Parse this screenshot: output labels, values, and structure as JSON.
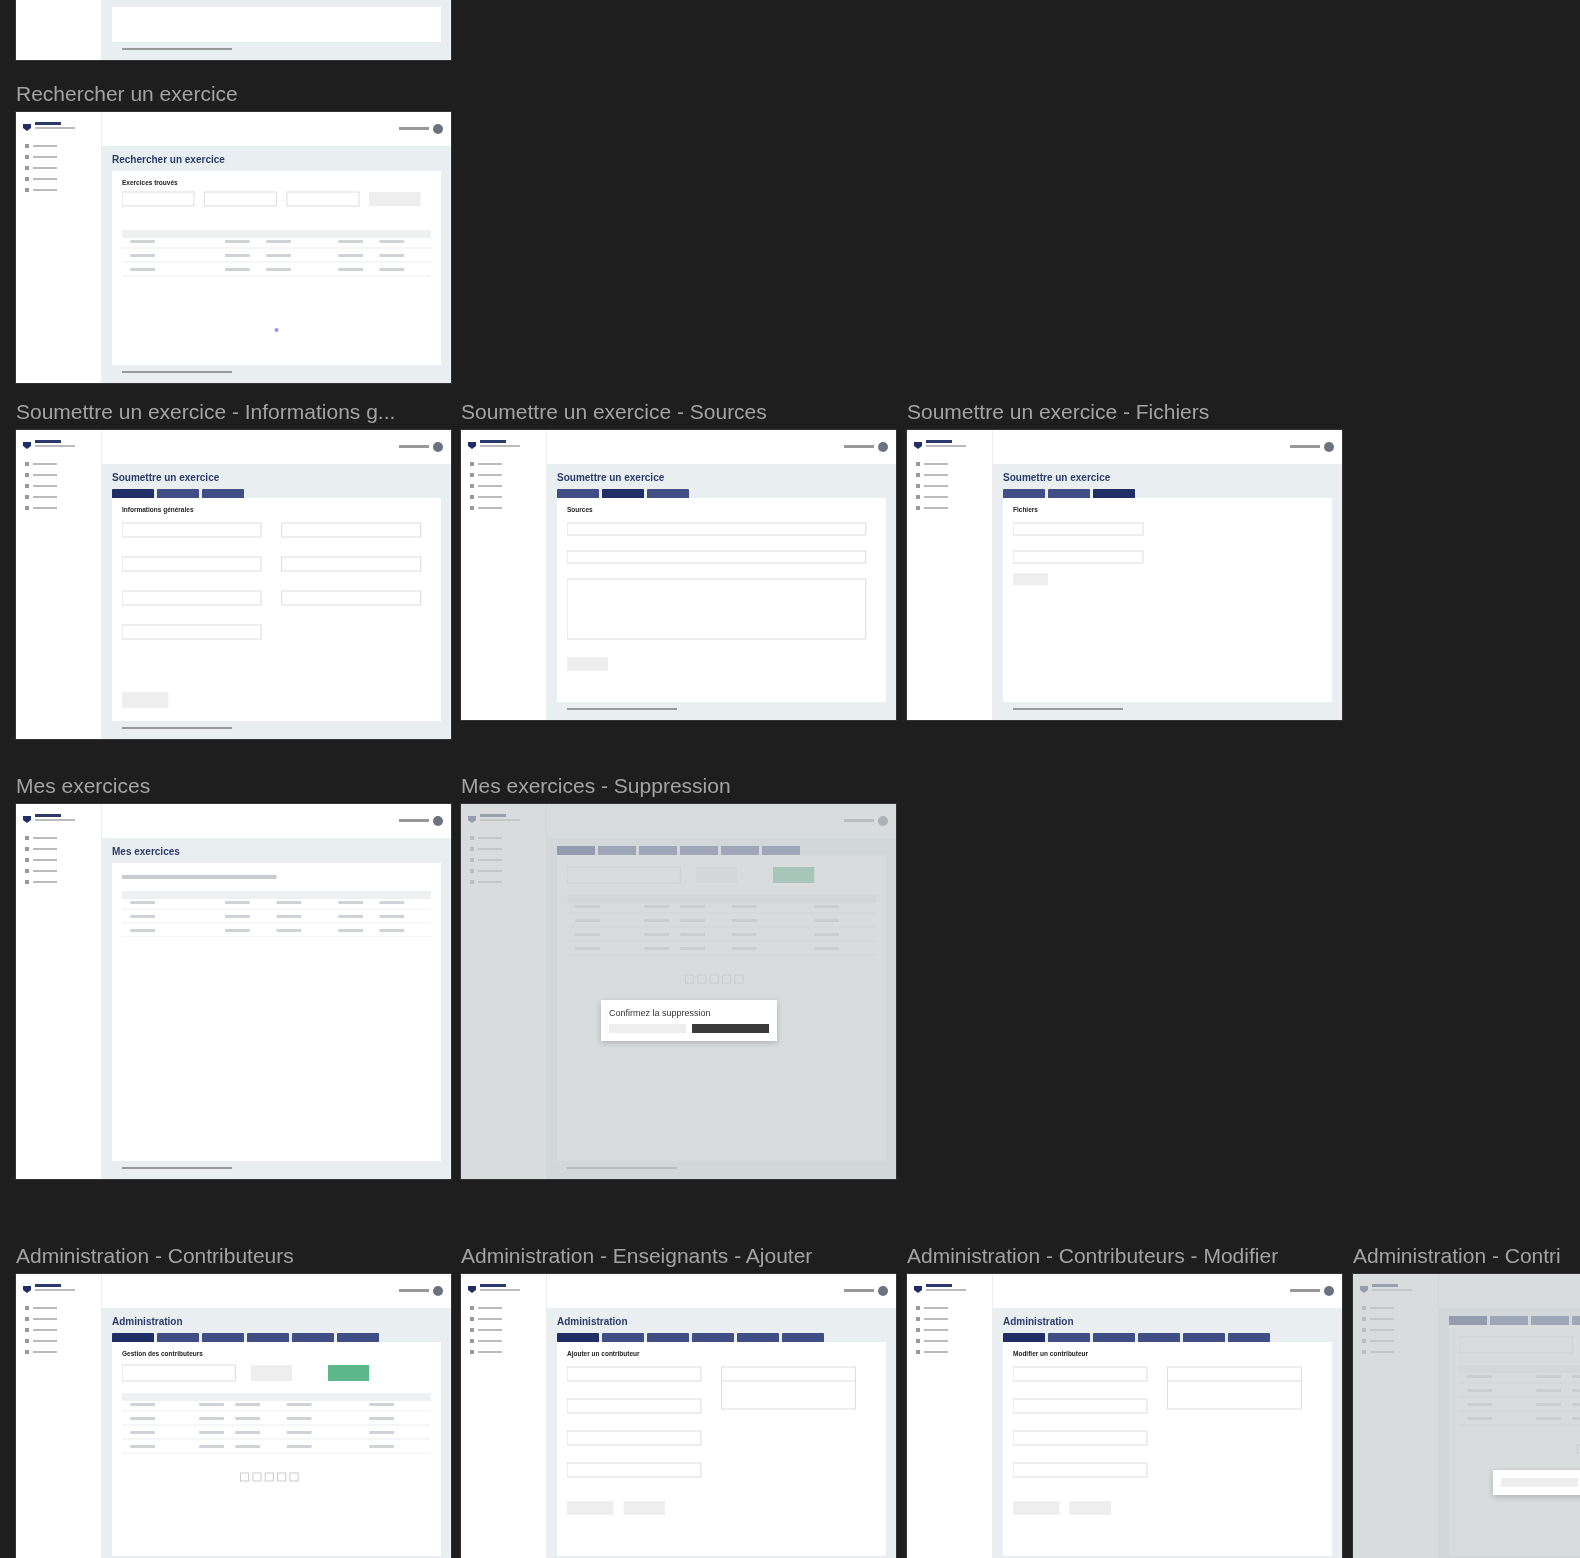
{
  "canvas_frames": [
    {
      "kind": "partial"
    },
    {
      "title": "Rechercher un exercice",
      "kind": "search",
      "heading": "Rechercher un exercice",
      "section": "Exercices trouvés"
    },
    {
      "title": "Soumettre un exercice - Informations g...",
      "kind": "form",
      "heading": "Soumettre un exercice",
      "tabs": [
        {
          "selected": true
        },
        {
          "selected": false
        },
        {
          "selected": false
        }
      ],
      "section": "Informations générales"
    },
    {
      "title": "Soumettre un exercice - Sources",
      "kind": "sources",
      "heading": "Soumettre un exercice",
      "tabs": [
        {
          "selected": false
        },
        {
          "selected": true
        },
        {
          "selected": false
        }
      ],
      "section": "Sources"
    },
    {
      "title": "Soumettre un exercice - Fichiers",
      "kind": "files",
      "heading": "Soumettre un exercice",
      "tabs": [
        {
          "selected": false
        },
        {
          "selected": false
        },
        {
          "selected": true
        }
      ],
      "section": "Fichiers"
    },
    {
      "title": "Mes exercices",
      "kind": "list",
      "heading": "Mes exercices"
    },
    {
      "title": "Mes exercices - Suppression",
      "kind": "admin-modal",
      "dialog_title": "Confirmez la suppression"
    },
    {
      "title": "Administration - Contributeurs",
      "kind": "admin-table",
      "heading": "Administration",
      "tabs": [
        {
          "selected": true
        },
        {
          "selected": false
        },
        {
          "selected": false
        },
        {
          "selected": false
        },
        {
          "selected": false
        },
        {
          "selected": false
        }
      ],
      "section": "Gestion des contributeurs"
    },
    {
      "title": "Administration - Enseignants - Ajouter",
      "kind": "admin-form",
      "heading": "Administration",
      "tabs": [
        {
          "selected": true
        },
        {
          "selected": false
        },
        {
          "selected": false
        },
        {
          "selected": false
        },
        {
          "selected": false
        },
        {
          "selected": false
        }
      ],
      "section": "Ajouter un contributeur"
    },
    {
      "title": "Administration - Contributeurs - Modifier",
      "kind": "admin-form",
      "heading": "Administration",
      "tabs": [
        {
          "selected": true
        },
        {
          "selected": false
        },
        {
          "selected": false
        },
        {
          "selected": false
        },
        {
          "selected": false
        },
        {
          "selected": false
        }
      ],
      "section": "Modifier un contributeur"
    },
    {
      "title": "Administration - Contri",
      "kind": "admin-modal"
    }
  ]
}
